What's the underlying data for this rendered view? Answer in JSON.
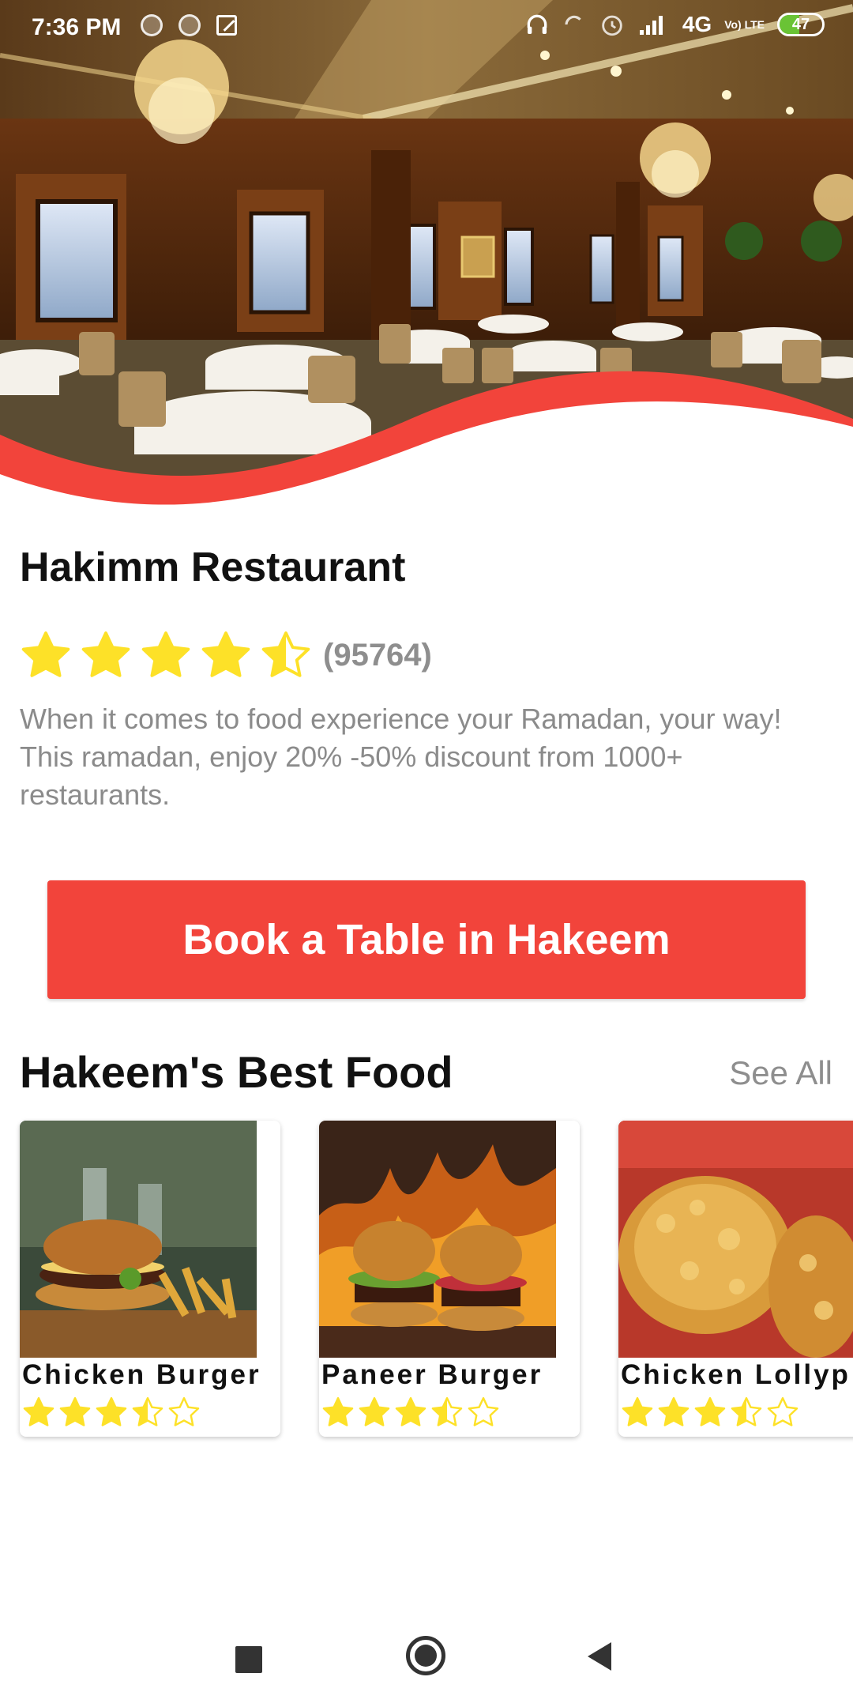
{
  "status_bar": {
    "time": "7:36 PM",
    "network": "4G",
    "volte": "Vo) LTE",
    "battery_level": 47,
    "battery_text": "47",
    "battery_color": "#6ac335"
  },
  "restaurant": {
    "name": "Hakimm Restaurant",
    "rating": 4.5,
    "review_count": "(95764)",
    "description": "When it comes to food experience your Ramadan, your way! This ramadan, enjoy 20% -50% discount from 1000+ restaurants."
  },
  "book_button": {
    "label": "Book a Table in Hakeem",
    "color": "#f2443b"
  },
  "best_food": {
    "title": "Hakeem's Best Food",
    "see_all": "See All",
    "items": [
      {
        "name": "Chicken Burger",
        "rating": 3.5
      },
      {
        "name": "Paneer Burger",
        "rating": 3.5
      },
      {
        "name": "Chicken Lollyp",
        "rating": 3.5
      }
    ]
  },
  "colors": {
    "accent": "#f2443b",
    "star": "#fde128"
  },
  "nav": {
    "icons": [
      "square-recents-icon",
      "circle-home-icon",
      "triangle-back-icon"
    ]
  }
}
